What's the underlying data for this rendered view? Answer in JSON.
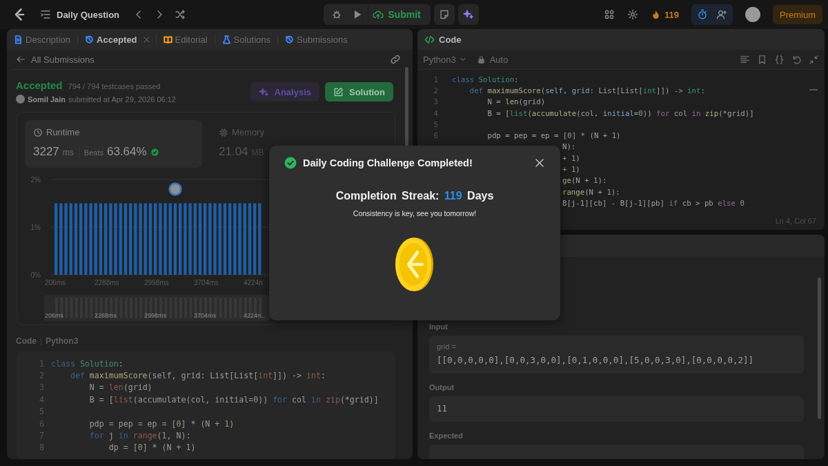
{
  "top_bar": {
    "title": "Daily Question",
    "submit": "Submit",
    "streak": "119",
    "premium": "Premium"
  },
  "left_panel": {
    "tabs": [
      {
        "label": "Description",
        "selected": false,
        "closable": false,
        "color": "#3b82f6"
      },
      {
        "label": "Accepted",
        "selected": true,
        "closable": true,
        "color": "#3b82f6"
      },
      {
        "label": "Editorial",
        "selected": false,
        "closable": false,
        "color": "#ffa116"
      },
      {
        "label": "Solutions",
        "selected": false,
        "closable": false,
        "color": "#3b82f6"
      },
      {
        "label": "Submissions",
        "selected": false,
        "closable": false,
        "color": "#3b82f6"
      }
    ],
    "back_link": "All Submissions",
    "status": "Accepted",
    "testcases": "794 / 794 testcases passed",
    "author": "Somil Jain",
    "submitted": "submitted at Apr 29, 2026 06:12",
    "buttons": [
      {
        "label": "Analysis",
        "kind": "analysis"
      },
      {
        "label": "Solution",
        "kind": "solution"
      }
    ],
    "stats": [
      {
        "kind": "runtime",
        "label": "Runtime",
        "value": "3227",
        "unit": "ms",
        "beats_label": "Beats",
        "beats": "63.64%",
        "selected": true
      },
      {
        "kind": "memory",
        "label": "Memory",
        "value": "21.04",
        "unit": "MB",
        "selected": false
      }
    ],
    "chart_data": {
      "type": "bar",
      "categories": [
        "206ms",
        null,
        null,
        null,
        null,
        null,
        null,
        null,
        null,
        null,
        "2288ms",
        null,
        null,
        null,
        null,
        null,
        null,
        null,
        null,
        null,
        "2998ms",
        null,
        null,
        null,
        null,
        null,
        null,
        null,
        null,
        null,
        "3704ms",
        null,
        null,
        null,
        null,
        null,
        null,
        null,
        null,
        null,
        "4224n",
        null
      ],
      "values": [
        1.5,
        1.5,
        1.5,
        1.5,
        1.5,
        1.5,
        1.5,
        1.5,
        1.5,
        1.5,
        1.5,
        1.5,
        1.5,
        1.5,
        1.5,
        1.5,
        1.5,
        1.5,
        1.5,
        1.5,
        1.5,
        1.5,
        1.5,
        1.5,
        1.5,
        1.5,
        1.5,
        1.5,
        1.5,
        1.5,
        1.5,
        1.5,
        1.5,
        1.5,
        1.5,
        1.5,
        1.5,
        1.5,
        1.5,
        1.5,
        1.5,
        1.5
      ],
      "ylim": [
        0,
        2
      ],
      "yticks": [
        {
          "value": 0,
          "label": "0%"
        },
        {
          "value": 1,
          "label": "1%"
        },
        {
          "value": 2,
          "label": "2%"
        }
      ]
    },
    "navigator": {
      "labels": [
        "206ms",
        "2288ms",
        "2998ms",
        "3704ms",
        "4224n..."
      ]
    },
    "code_title": "Code",
    "code_language": "Python3",
    "code_lines": [
      {
        "number": "1",
        "segments": [
          {
            "text": "class ",
            "kind": "keyword"
          },
          {
            "text": "Solution",
            "kind": "class"
          },
          {
            "text": ":",
            "kind": "plain"
          }
        ]
      },
      {
        "number": "2",
        "segments": [
          {
            "text": "    def ",
            "kind": "keyword"
          },
          {
            "text": "maximumScore",
            "kind": "function"
          },
          {
            "text": "(self, grid: List[List[",
            "kind": "plain"
          },
          {
            "text": "int",
            "kind": "builtin"
          },
          {
            "text": "]]) -> ",
            "kind": "plain"
          },
          {
            "text": "int",
            "kind": "builtin"
          },
          {
            "text": ":",
            "kind": "plain"
          }
        ]
      },
      {
        "number": "3",
        "segments": [
          {
            "text": "        N = ",
            "kind": "plain"
          },
          {
            "text": "len",
            "kind": "builtin"
          },
          {
            "text": "(grid)",
            "kind": "plain"
          }
        ]
      },
      {
        "number": "4",
        "segments": [
          {
            "text": "        B = [",
            "kind": "plain"
          },
          {
            "text": "list",
            "kind": "builtin"
          },
          {
            "text": "(accumulate(col, initial=",
            "kind": "plain"
          },
          {
            "text": "0",
            "kind": "number"
          },
          {
            "text": ")) ",
            "kind": "plain"
          },
          {
            "text": "for",
            "kind": "keyword"
          },
          {
            "text": " col ",
            "kind": "plain"
          },
          {
            "text": "in ",
            "kind": "keyword"
          },
          {
            "text": "zip",
            "kind": "builtin"
          },
          {
            "text": "(*grid)]",
            "kind": "plain"
          }
        ]
      },
      {
        "number": "5"
      },
      {
        "number": "6",
        "segments": [
          {
            "text": "        pdp = pep = ep = [",
            "kind": "plain"
          },
          {
            "text": "0",
            "kind": "number"
          },
          {
            "text": "] * (N + ",
            "kind": "plain"
          },
          {
            "text": "1",
            "kind": "number"
          },
          {
            "text": ")",
            "kind": "plain"
          }
        ]
      },
      {
        "number": "7",
        "segments": [
          {
            "text": "        for",
            "kind": "keyword"
          },
          {
            "text": " j ",
            "kind": "plain"
          },
          {
            "text": "in ",
            "kind": "keyword"
          },
          {
            "text": "range",
            "kind": "builtin"
          },
          {
            "text": "(",
            "kind": "plain"
          },
          {
            "text": "1",
            "kind": "number"
          },
          {
            "text": ", N):",
            "kind": "plain"
          }
        ]
      },
      {
        "number": "8",
        "segments": [
          {
            "text": "            dp = [",
            "kind": "plain"
          },
          {
            "text": "0",
            "kind": "number"
          },
          {
            "text": "] * (N + ",
            "kind": "plain"
          },
          {
            "text": "1",
            "kind": "number"
          },
          {
            "text": ")",
            "kind": "plain"
          }
        ]
      }
    ]
  },
  "editor": {
    "title": "Code",
    "language": "Python3",
    "mode": "Auto",
    "cursor": "Ln 4, Col 67",
    "lines": [
      {
        "kind": "full",
        "number": "1",
        "segments": [
          {
            "text": "class ",
            "kind": "keyword"
          },
          {
            "text": "Solution",
            "kind": "class"
          },
          {
            "text": ":",
            "kind": "plain"
          }
        ]
      },
      {
        "kind": "full",
        "number": "2",
        "segments": [
          {
            "text": "    def ",
            "kind": "keyword"
          },
          {
            "text": "maximumScore",
            "kind": "function"
          },
          {
            "text": "(",
            "kind": "plain"
          },
          {
            "text": "self",
            "kind": "param"
          },
          {
            "text": ", ",
            "kind": "plain"
          },
          {
            "text": "grid",
            "kind": "param"
          },
          {
            "text": ": List[List[",
            "kind": "plain"
          },
          {
            "text": "int",
            "kind": "class"
          },
          {
            "text": "]]) -> ",
            "kind": "plain"
          },
          {
            "text": "int",
            "kind": "class"
          },
          {
            "text": ":",
            "kind": "plain"
          }
        ]
      },
      {
        "kind": "full",
        "number": "3",
        "segments": [
          {
            "text": "        N = ",
            "kind": "plain"
          },
          {
            "text": "len",
            "kind": "function"
          },
          {
            "text": "(grid)",
            "kind": "plain"
          }
        ]
      },
      {
        "kind": "full",
        "number": "4",
        "segments": [
          {
            "text": "        B = [",
            "kind": "plain"
          },
          {
            "text": "list",
            "kind": "class"
          },
          {
            "text": "(",
            "kind": "plain"
          },
          {
            "text": "accumulate",
            "kind": "function"
          },
          {
            "text": "(col, ",
            "kind": "plain"
          },
          {
            "text": "initial",
            "kind": "param"
          },
          {
            "text": "=",
            "kind": "plain"
          },
          {
            "text": "0",
            "kind": "number"
          },
          {
            "text": ")) ",
            "kind": "plain"
          },
          {
            "text": "for",
            "kind": "control"
          },
          {
            "text": " col ",
            "kind": "plain"
          },
          {
            "text": "in ",
            "kind": "control"
          },
          {
            "text": "zip",
            "kind": "function"
          },
          {
            "text": "(*grid)]",
            "kind": "plain"
          }
        ]
      },
      {
        "kind": "full",
        "number": "5"
      },
      {
        "kind": "full",
        "number": "6",
        "segments": [
          {
            "text": "        pdp = pep = ep = [",
            "kind": "plain"
          },
          {
            "text": "0",
            "kind": "number"
          },
          {
            "text": "] * (N + ",
            "kind": "plain"
          },
          {
            "text": "1",
            "kind": "number"
          },
          {
            "text": ")",
            "kind": "plain"
          }
        ]
      },
      {
        "kind": "partial",
        "segments": [
          {
            "text": "N):",
            "kind": "plain"
          }
        ]
      },
      {
        "kind": "partial",
        "segments": [
          {
            "text": "+ ",
            "kind": "plain"
          },
          {
            "text": "1",
            "kind": "number"
          },
          {
            "text": ")",
            "kind": "plain"
          }
        ]
      },
      {
        "kind": "partial",
        "segments": [
          {
            "text": "+ ",
            "kind": "plain"
          },
          {
            "text": "1",
            "kind": "number"
          },
          {
            "text": ")",
            "kind": "plain"
          }
        ]
      },
      {
        "kind": "partial",
        "segments": [
          {
            "text": "ge",
            "kind": "function"
          },
          {
            "text": "(N + ",
            "kind": "plain"
          },
          {
            "text": "1",
            "kind": "number"
          },
          {
            "text": "):",
            "kind": "plain"
          }
        ]
      },
      {
        "kind": "partial",
        "segments": [
          {
            "text": "range",
            "kind": "function"
          },
          {
            "text": "(N + ",
            "kind": "plain"
          },
          {
            "text": "1",
            "kind": "number"
          },
          {
            "text": "):",
            "kind": "plain"
          }
        ]
      },
      {
        "kind": "partial",
        "segments": [
          {
            "text": "B[j-1][cb] - B[j-1][pb] ",
            "kind": "plain"
          },
          {
            "text": "if",
            "kind": "control"
          },
          {
            "text": " cb > pb ",
            "kind": "plain"
          },
          {
            "text": "else ",
            "kind": "control"
          },
          {
            "text": "0",
            "kind": "number"
          }
        ]
      }
    ]
  },
  "testcase_panel": {
    "fields": [
      {
        "label": "Input",
        "name": "grid =",
        "value": "[[0,0,0,0,0],[0,0,3,0,0],[0,1,0,0,0],[5,0,0,3,0],[0,0,0,0,2]]"
      },
      {
        "label": "Output",
        "value": "11"
      },
      {
        "label": "Expected"
      }
    ]
  },
  "modal": {
    "title": "Daily Coding Challenge Completed!",
    "streak_label": "Completion Streak:",
    "streak": "119",
    "streak_unit": "Days",
    "message": "Consistency is key, see you tomorrow!"
  }
}
